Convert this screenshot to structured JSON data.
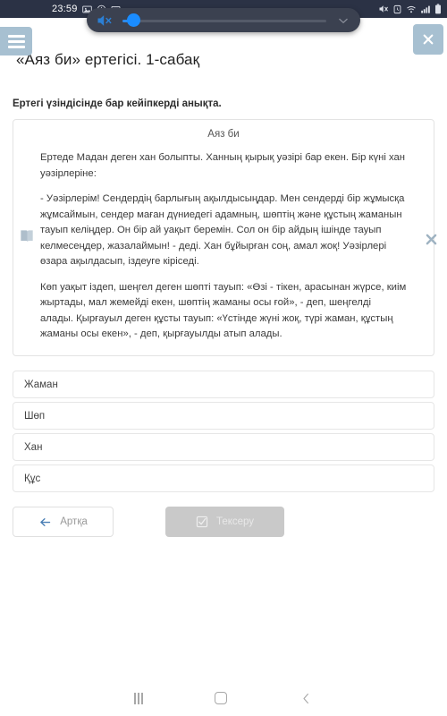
{
  "status_bar": {
    "clock": "23:59",
    "left_icons": [
      "screenshot-icon",
      "app-badge-icon",
      "keyboard-icon"
    ],
    "right_icons": [
      "mute-icon",
      "alarm-icon",
      "wifi-icon",
      "signal-icon",
      "battery-icon"
    ],
    "background_color": "#2b3245"
  },
  "volume_overlay": {
    "mute_icon": "volume-mute-icon",
    "expand_icon": "chevron-down-icon",
    "level_percent": 4,
    "thumb_color": "#1a8cff",
    "panel_color": "#3b4150"
  },
  "header": {
    "menu_icon": "hamburger-icon",
    "close_icon": "close-icon",
    "button_color": "#a7c0d1",
    "title": "«Аяз би» ертегісі. 1-сабақ"
  },
  "question": {
    "prompt": "Ертегі үзіндісінде бар кейіпкерді анықта."
  },
  "text_card": {
    "heading": "Аяз би",
    "side_icon": "book-icon",
    "dismiss_icon": "close-icon",
    "paragraphs": [
      "Ертеде Мадан деген хан болыпты. Ханның қырық уәзірі бар екен. Бір күні хан уәзірлеріне:",
      "- Уәзірлерім! Сендердің барлығың ақылдысыңдар. Мен сендерді бір жұмысқа жұмсаймын, сендер маған дүниедегі адамның, шөптің және құстың жаманын тауып келіңдер. Он бір ай уақыт беремін. Сол он бір айдың ішінде тауып келмесеңдер, жазалаймын! - деді. Хан бұйырған соң, амал жоқ! Уәзірлері өзара ақылдасып, іздеуге кіріседі.",
      "Көп уақыт іздеп, шеңгел деген шөпті тауып: «Өзі - тікен, арасынан жүрсе, киім жыртады, мал жемейді екен, шөптің жаманы осы ғой», - деп, шеңгелді алады. Қырғауыл деген құсты тауып: «Үстінде жүні жоқ, түрі жаман, құстың жаманы осы екен», - деп, қырғауылды атып алады."
    ]
  },
  "options": [
    {
      "label": "Жаман"
    },
    {
      "label": "Шөп"
    },
    {
      "label": "Хан"
    },
    {
      "label": "Құс"
    }
  ],
  "footer": {
    "back_label": "Артқа",
    "back_icon": "arrow-left-icon",
    "check_label": "Тексеру",
    "check_icon": "checkbox-icon",
    "check_enabled": false,
    "check_button_color": "#c9c9c9"
  },
  "nav_bar": {
    "recents_icon": "recents-icon",
    "home_icon": "home-icon",
    "back_icon": "back-chevron-icon"
  }
}
